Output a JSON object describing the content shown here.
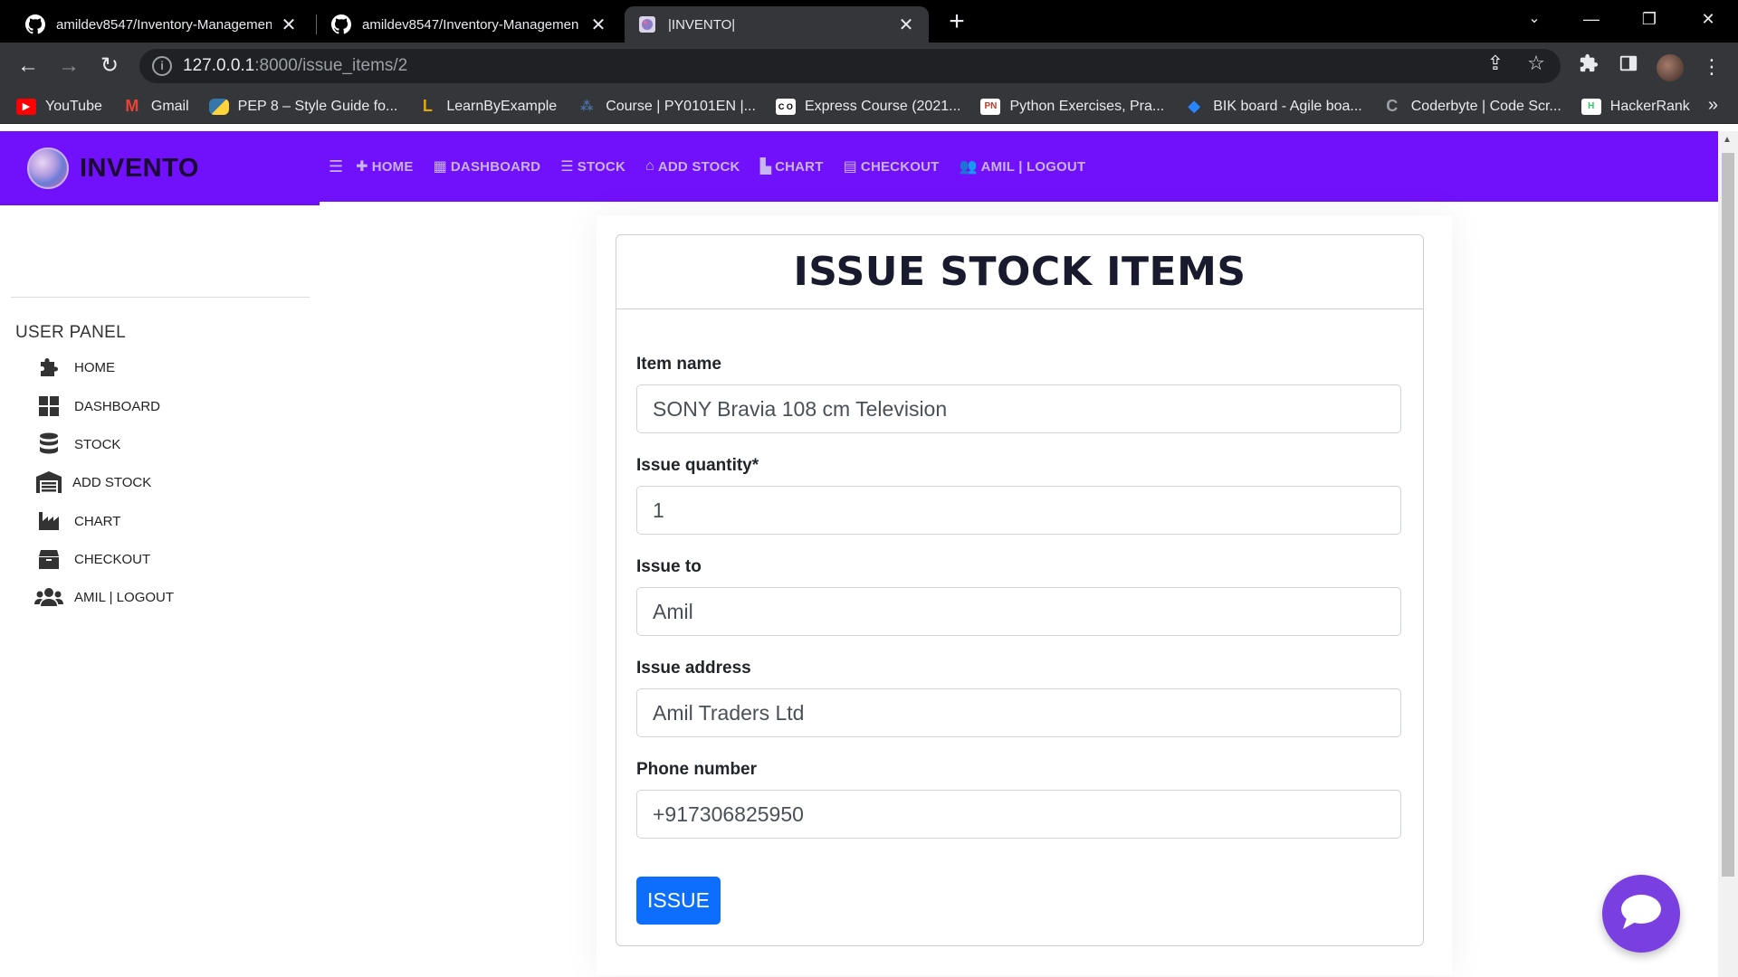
{
  "browser": {
    "tabs": [
      {
        "title": "amildev8547/Inventory-Managemen",
        "icon": "github-icon",
        "active": false
      },
      {
        "title": "amildev8547/Inventory-Managemen",
        "icon": "github-icon",
        "active": false
      },
      {
        "title": "|INVENTO|",
        "icon": "invento-favicon",
        "active": true
      }
    ],
    "url_host": "127.0.0.1",
    "url_path": ":8000/issue_items/2",
    "bookmarks": [
      {
        "label": "YouTube",
        "icon": "youtube-icon",
        "color": "#ff0000"
      },
      {
        "label": "Gmail",
        "icon": "gmail-icon",
        "color": "#ea4335"
      },
      {
        "label": "PEP 8 – Style Guide fo...",
        "icon": "python-icon",
        "color": "#3776ab"
      },
      {
        "label": "LearnByExample",
        "icon": "learnbyexample-icon",
        "color": "#e0a800"
      },
      {
        "label": "Course | PY0101EN |...",
        "icon": "course-icon",
        "color": "#4a6fa5"
      },
      {
        "label": "Express Course (2021...",
        "icon": "express-icon",
        "color": "#222222"
      },
      {
        "label": "Python Exercises, Pra...",
        "icon": "pynative-icon",
        "color": "#c0392b"
      },
      {
        "label": "BIK board - Agile boa...",
        "icon": "jira-icon",
        "color": "#2684ff"
      },
      {
        "label": "Coderbyte | Code Scr...",
        "icon": "coderbyte-icon",
        "color": "#1a1a1a"
      },
      {
        "label": "HackerRank",
        "icon": "hackerrank-icon",
        "color": "#2ec866"
      }
    ]
  },
  "app": {
    "brand": "INVENTO",
    "topnav": [
      {
        "label": "HOME",
        "icon": "puzzle-icon"
      },
      {
        "label": "DASHBOARD",
        "icon": "dashboard-icon"
      },
      {
        "label": "STOCK",
        "icon": "database-icon"
      },
      {
        "label": "ADD STOCK",
        "icon": "warehouse-icon"
      },
      {
        "label": "CHART",
        "icon": "chart-icon"
      },
      {
        "label": "CHECKOUT",
        "icon": "box-icon"
      },
      {
        "label": "AMIL | LOGOUT",
        "icon": "users-icon"
      }
    ],
    "sidebar": {
      "heading": "USER PANEL",
      "items": [
        {
          "label": "HOME",
          "icon": "puzzle-icon"
        },
        {
          "label": "DASHBOARD",
          "icon": "dashboard-icon"
        },
        {
          "label": "STOCK",
          "icon": "database-icon"
        },
        {
          "label": "ADD STOCK",
          "icon": "warehouse-icon"
        },
        {
          "label": "CHART",
          "icon": "chart-icon"
        },
        {
          "label": "CHECKOUT",
          "icon": "box-icon"
        },
        {
          "label": "AMIL | LOGOUT",
          "icon": "users-icon"
        }
      ]
    }
  },
  "form": {
    "title": "ISSUE STOCK ITEMS",
    "item_name_label": "Item name",
    "item_name_value": "SONY Bravia 108 cm Television",
    "issue_quantity_label": "Issue quantity*",
    "issue_quantity_value": "1",
    "issue_to_label": "Issue to",
    "issue_to_value": "Amil",
    "issue_address_label": "Issue address",
    "issue_address_value": "Amil Traders Ltd",
    "phone_label": "Phone number",
    "phone_value": "+917306825950",
    "submit_label": "ISSUE"
  },
  "colors": {
    "brand_purple": "#7110fa",
    "button_blue": "#0d6efd",
    "chat_purple": "#7a3fe0"
  }
}
